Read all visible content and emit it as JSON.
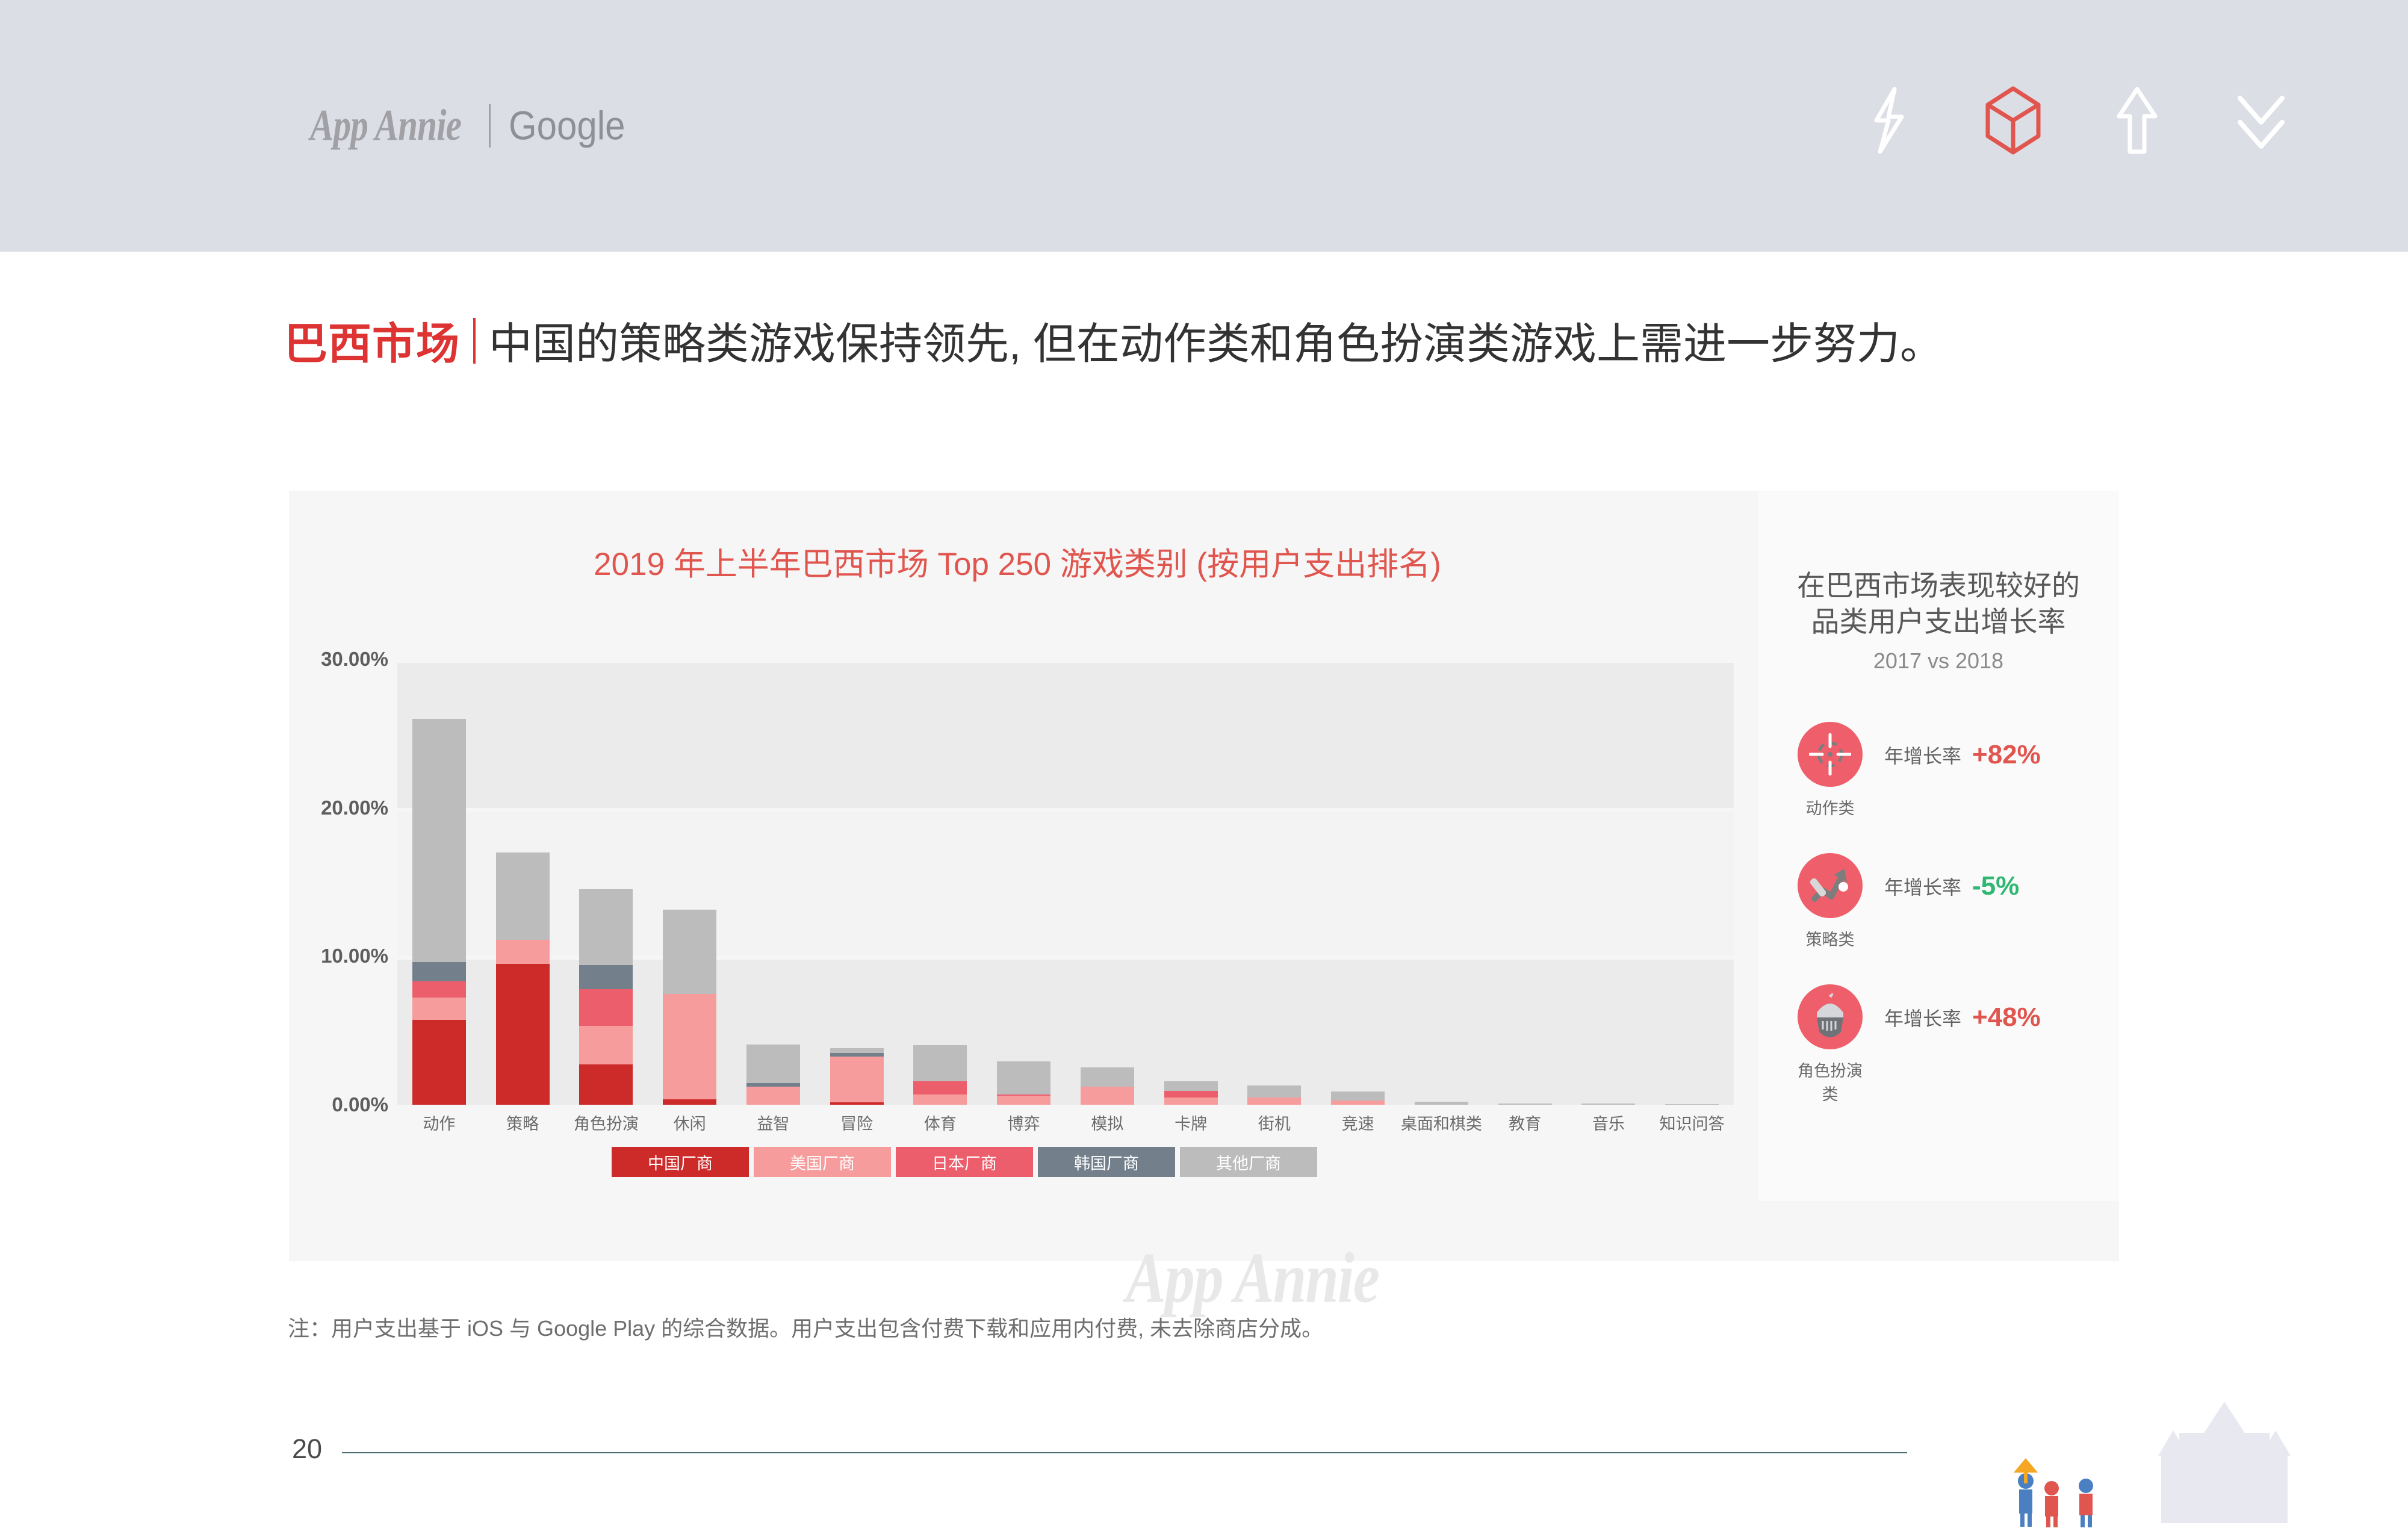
{
  "header": {
    "brand_primary": "App Annie",
    "brand_secondary": "Google",
    "icons": [
      "lightning-bolt-icon",
      "cube-icon",
      "up-arrow-icon",
      "double-chevron-down-icon"
    ]
  },
  "title": {
    "highlight": "巴西市场",
    "rest": "中国的策略类游戏保持领先, 但在动作类和角色扮演类游戏上需进一步努力。"
  },
  "chart": {
    "title": "2019 年上半年巴西市场 Top 250 游戏类别 (按用户支出排名)",
    "watermark": "App Annie"
  },
  "legend": [
    {
      "label": "中国厂商",
      "color": "#cd2a2a"
    },
    {
      "label": "美国厂商",
      "color": "#f69c9c"
    },
    {
      "label": "日本厂商",
      "color": "#ed5e6d"
    },
    {
      "label": "韩国厂商",
      "color": "#73808c"
    },
    {
      "label": "其他厂商",
      "color": "#bcbcbc"
    }
  ],
  "panel": {
    "title": "在巴西市场表现较好的\n品类用户支出增长率",
    "title_line1": "在巴西市场表现较好的",
    "title_line2": "品类用户支出增长率",
    "subtitle": "2017 vs 2018",
    "items": [
      {
        "category": "动作类",
        "label": "年增长率",
        "value": "+82%",
        "value_color": "#e0564f",
        "icon": "crosshair-target-icon"
      },
      {
        "category": "策略类",
        "label": "年增长率",
        "value": "-5%",
        "value_color": "#2eb872",
        "icon": "strategy-arrow-icon"
      },
      {
        "category": "角色扮演类",
        "label": "年增长率",
        "value": "+48%",
        "value_color": "#e0564f",
        "icon": "knight-helmet-icon"
      }
    ]
  },
  "footnote": "注：用户支出基于 iOS 与 Google Play 的综合数据。用户支出包含付费下载和应用内付费, 未去除商店分成。",
  "page_number": "20",
  "chart_data": {
    "type": "bar",
    "stacked": true,
    "title": "2019 年上半年巴西市场 Top 250 游戏类别 (按用户支出排名)",
    "xlabel": "",
    "ylabel": "",
    "ylim": [
      0,
      30
    ],
    "ytick_labels": [
      "0.00%",
      "10.00%",
      "20.00%",
      "30.00%"
    ],
    "yticks": [
      0,
      10,
      20,
      30
    ],
    "grid": true,
    "legend_position": "bottom",
    "categories": [
      "动作",
      "策略",
      "角色扮演",
      "休闲",
      "益智",
      "冒险",
      "体育",
      "博弈",
      "模拟",
      "卡牌",
      "街机",
      "竞速",
      "桌面和棋类",
      "教育",
      "音乐",
      "知识问答"
    ],
    "series": [
      {
        "name": "中国厂商",
        "color": "#cd2a2a",
        "values": [
          5.7,
          9.5,
          2.7,
          0.35,
          0.0,
          0.15,
          0.0,
          0.0,
          0.0,
          0.0,
          0.0,
          0.0,
          0.0,
          0.0,
          0.0,
          0.0
        ]
      },
      {
        "name": "美国厂商",
        "color": "#f69c9c",
        "values": [
          1.5,
          1.6,
          2.6,
          7.1,
          1.2,
          3.1,
          0.7,
          0.6,
          1.2,
          0.5,
          0.5,
          0.3,
          0.0,
          0.0,
          0.0,
          0.0
        ]
      },
      {
        "name": "日本厂商",
        "color": "#ed5e6d",
        "values": [
          1.1,
          0.0,
          2.5,
          0.0,
          0.0,
          0.0,
          0.9,
          0.1,
          0.0,
          0.45,
          0.0,
          0.0,
          0.0,
          0.0,
          0.0,
          0.0
        ]
      },
      {
        "name": "韩国厂商",
        "color": "#73808c",
        "values": [
          1.3,
          0.0,
          1.6,
          0.0,
          0.25,
          0.25,
          0.0,
          0.0,
          0.0,
          0.0,
          0.0,
          0.0,
          0.0,
          0.0,
          0.0,
          0.0
        ]
      },
      {
        "name": "其他厂商",
        "color": "#bcbcbc",
        "values": [
          16.4,
          5.9,
          5.1,
          5.7,
          2.6,
          0.3,
          2.4,
          2.2,
          1.3,
          0.65,
          0.8,
          0.6,
          0.2,
          0.1,
          0.08,
          0.05
        ]
      }
    ],
    "totals": [
      26.0,
      17.0,
      14.5,
      13.15,
      4.05,
      3.8,
      4.0,
      2.9,
      2.5,
      1.6,
      1.3,
      0.9,
      0.2,
      0.1,
      0.08,
      0.05
    ]
  }
}
